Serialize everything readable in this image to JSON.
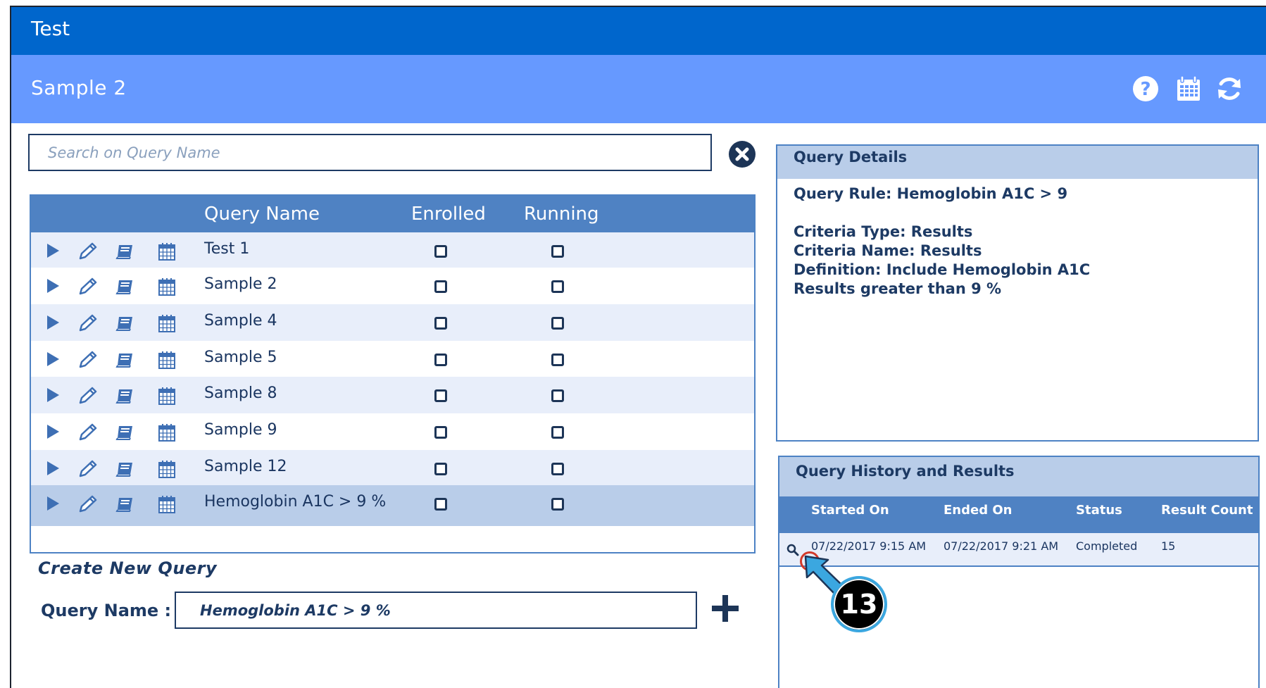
{
  "app": {
    "title": "Test"
  },
  "page": {
    "title": "Sample 2"
  },
  "header_icons": [
    "help-icon",
    "calendar-icon",
    "refresh-icon"
  ],
  "search": {
    "placeholder": "Search on Query Name",
    "value": ""
  },
  "query_table": {
    "columns": {
      "name": "Query Name",
      "enrolled": "Enrolled",
      "running": "Running"
    },
    "rows": [
      {
        "name": "Test 1",
        "enrolled": false,
        "running": false,
        "selected": false
      },
      {
        "name": "Sample 2",
        "enrolled": false,
        "running": false,
        "selected": false
      },
      {
        "name": "Sample 4",
        "enrolled": false,
        "running": false,
        "selected": false
      },
      {
        "name": "Sample 5",
        "enrolled": false,
        "running": false,
        "selected": false
      },
      {
        "name": "Sample 8",
        "enrolled": false,
        "running": false,
        "selected": false
      },
      {
        "name": "Sample 9",
        "enrolled": false,
        "running": false,
        "selected": false
      },
      {
        "name": "Sample 12",
        "enrolled": false,
        "running": false,
        "selected": false
      },
      {
        "name": "Hemoglobin A1C > 9 %",
        "enrolled": false,
        "running": false,
        "selected": true
      }
    ]
  },
  "create_query": {
    "title": "Create New Query",
    "name_label": "Query Name :",
    "name_value": "Hemoglobin A1C > 9 %"
  },
  "query_details": {
    "title": "Query Details",
    "rule": "Query Rule: Hemoglobin A1C > 9",
    "criteria_type": "Criteria Type: Results",
    "criteria_name": "Criteria Name: Results",
    "definition": "Definition: Include Hemoglobin A1C",
    "results": "Results greater than 9 %"
  },
  "query_history": {
    "title": "Query History and Results",
    "columns": {
      "started": "Started On",
      "ended": "Ended On",
      "status": "Status",
      "count": "Result Count"
    },
    "rows": [
      {
        "started": "07/22/2017 9:15 AM",
        "ended": "07/22/2017 9:21 AM",
        "status": "Completed",
        "count": "15"
      }
    ]
  },
  "annotation": {
    "step": "13"
  },
  "colors": {
    "titlebar": "#0066cc",
    "subheader": "#6699ff",
    "table_header": "#4f82c3",
    "row_alt": "#e8eefa",
    "row_selected": "#b9cde9",
    "panel_header": "#b9cde9",
    "text_dark": "#1d3a64",
    "callout_ring": "#3ba7e0",
    "target_ring": "#d23a2a"
  }
}
